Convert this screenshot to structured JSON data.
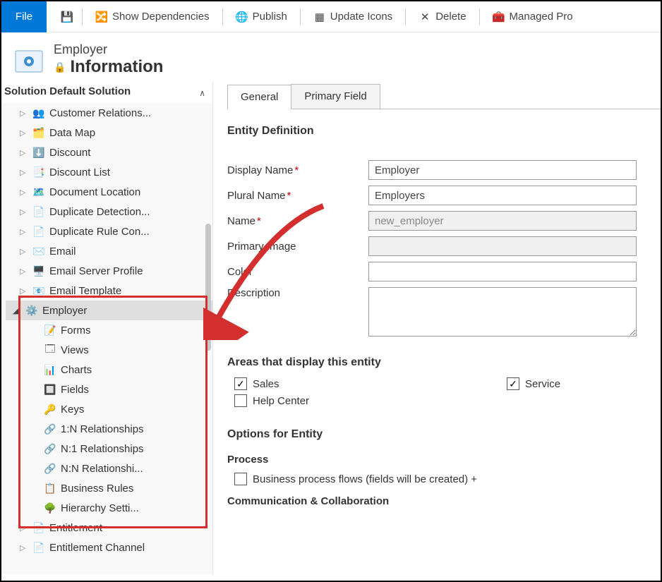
{
  "toolbar": {
    "file": "File",
    "save_icon": "save-icon",
    "show_dependencies": "Show Dependencies",
    "publish": "Publish",
    "update_icons": "Update Icons",
    "delete": "Delete",
    "managed_prop": "Managed Pro"
  },
  "header": {
    "entity_name": "Employer",
    "info": "Information"
  },
  "sidebar": {
    "title": "Solution Default Solution",
    "items": [
      {
        "label": "Customer Relations...",
        "icon": "👥",
        "exp": "▷"
      },
      {
        "label": "Data Map",
        "icon": "🗂️",
        "exp": "▷"
      },
      {
        "label": "Discount",
        "icon": "⬇️",
        "exp": "▷"
      },
      {
        "label": "Discount List",
        "icon": "📑",
        "exp": "▷"
      },
      {
        "label": "Document Location",
        "icon": "🗺️",
        "exp": "▷"
      },
      {
        "label": "Duplicate Detection...",
        "icon": "📄",
        "exp": "▷"
      },
      {
        "label": "Duplicate Rule Con...",
        "icon": "📄",
        "exp": "▷"
      },
      {
        "label": "Email",
        "icon": "✉️",
        "exp": "▷"
      },
      {
        "label": "Email Server Profile",
        "icon": "🖥️",
        "exp": "▷"
      },
      {
        "label": "Email Template",
        "icon": "📧",
        "exp": "▷"
      }
    ],
    "employer": {
      "label": "Employer",
      "exp": "◢",
      "icon": "⚙️"
    },
    "children": [
      {
        "label": "Forms",
        "icon": "📝"
      },
      {
        "label": "Views",
        "icon": "🗔"
      },
      {
        "label": "Charts",
        "icon": "📊"
      },
      {
        "label": "Fields",
        "icon": "🔲"
      },
      {
        "label": "Keys",
        "icon": "🔑"
      },
      {
        "label": "1:N Relationships",
        "icon": "🔗"
      },
      {
        "label": "N:1 Relationships",
        "icon": "🔗"
      },
      {
        "label": "N:N Relationshi...",
        "icon": "🔗"
      },
      {
        "label": "Business Rules",
        "icon": "📋"
      },
      {
        "label": "Hierarchy Setti...",
        "icon": "🌳"
      }
    ],
    "after": [
      {
        "label": "Entitlement",
        "icon": "📄",
        "exp": "▷"
      },
      {
        "label": "Entitlement Channel",
        "icon": "📄",
        "exp": "▷"
      }
    ]
  },
  "tabs": {
    "general": "General",
    "primary_field": "Primary Field"
  },
  "form": {
    "section1": "Entity Definition",
    "display_name_label": "Display Name",
    "display_name_value": "Employer",
    "plural_name_label": "Plural Name",
    "plural_name_value": "Employers",
    "name_label": "Name",
    "name_value": "new_employer",
    "primary_image_label": "Primary Image",
    "color_label": "Color",
    "description_label": "Description",
    "areas_title": "Areas that display this entity",
    "sales": "Sales",
    "service": "Service",
    "help_center": "Help Center",
    "options_title": "Options for Entity",
    "process_title": "Process",
    "bpf_label": "Business process flows (fields will be created) +",
    "comm_title": "Communication & Collaboration"
  }
}
